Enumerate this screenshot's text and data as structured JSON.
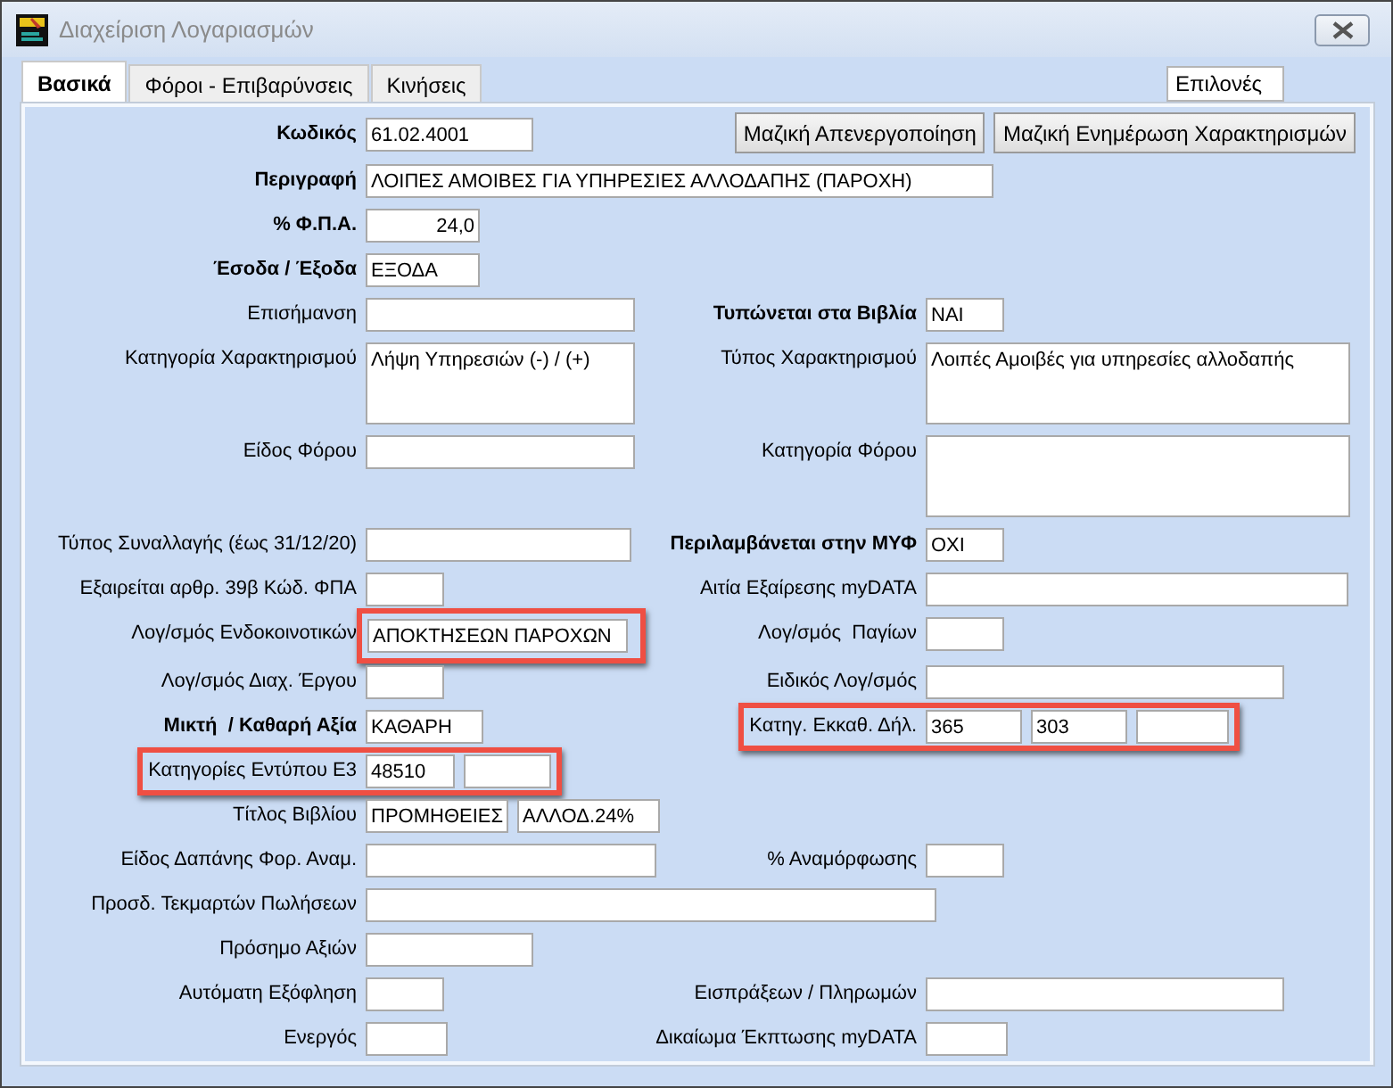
{
  "window": {
    "title": "Διαχείριση Λογαριασμών"
  },
  "tabs": [
    {
      "label": "Βασικά",
      "selected": true
    },
    {
      "label": "Φόροι - Επιβαρύνσεις",
      "selected": false
    },
    {
      "label": "Κινήσεις",
      "selected": false
    }
  ],
  "options_label": "Επιλονές",
  "buttons": [
    "Μαζική Απενεργοποίηση",
    "Μαζική Ενημέρωση Χαρακτηρισμών"
  ],
  "rows": [
    {
      "left": {
        "label": "Κωδικός",
        "bold": true,
        "fields": [
          {
            "kind": "text",
            "value": "61.02.4001"
          }
        ]
      }
    },
    {
      "left": {
        "label": "Περιγραφή",
        "bold": true,
        "fields": [
          {
            "kind": "text",
            "value": "ΛΟΙΠΕΣ ΑΜΟΙΒΕΣ ΓΙΑ ΥΠΗΡΕΣΙΕΣ ΑΛΛΟΔΑΠΗΣ (ΠΑΡΟΧΗ)"
          }
        ]
      }
    },
    {
      "left": {
        "label": "% Φ.Π.Α.",
        "bold": true,
        "fields": [
          {
            "kind": "number",
            "value": "24,0"
          }
        ]
      }
    },
    {
      "left": {
        "label": "Έσοδα / Έξοδα",
        "bold": true,
        "fields": [
          {
            "kind": "text",
            "value": "ΕΞΟΔΑ"
          }
        ]
      }
    },
    {
      "left": {
        "label": "Επισήμανση",
        "bold": false,
        "fields": [
          {
            "kind": "text"
          }
        ]
      },
      "right": {
        "label": "Τυπώνεται στα Βιβλία",
        "bold": true,
        "fields": [
          {
            "kind": "text",
            "value": "ΝΑΙ"
          }
        ]
      }
    },
    {
      "left": {
        "label": "Κατηγορία Χαρακτηρισμού",
        "bold": false,
        "fields": [
          {
            "kind": "textarea",
            "value": "Λήψη Υπηρεσιών (-) / (+)"
          }
        ]
      },
      "right": {
        "label": "Τύπος Χαρακτηρισμού",
        "bold": false,
        "fields": [
          {
            "kind": "textarea",
            "value": "Λοιπές Αμοιβές για υπηρεσίες αλλοδαπής"
          }
        ]
      }
    },
    {
      "left": {
        "label": "Είδος Φόρου",
        "bold": false,
        "fields": [
          {
            "kind": "text"
          }
        ]
      },
      "right": {
        "label": "Κατηγορία Φόρου",
        "bold": false,
        "fields": [
          {
            "kind": "textarea"
          }
        ]
      }
    },
    {
      "left": {
        "label": "Τύπος Συναλλαγής (έως 31/12/20)",
        "bold": false,
        "fields": [
          {
            "kind": "text"
          }
        ]
      },
      "right": {
        "label": "Περιλαμβάνεται στην ΜΥΦ",
        "bold": true,
        "fields": [
          {
            "kind": "text",
            "value": "ΟΧΙ"
          }
        ]
      }
    },
    {
      "left": {
        "label": "Εξαιρείται αρθρ. 39β Κώδ. ΦΠΑ",
        "bold": false,
        "fields": [
          {
            "kind": "text"
          }
        ]
      },
      "right": {
        "label": "Αιτία Εξαίρεσης myDATA",
        "bold": false,
        "fields": [
          {
            "kind": "text"
          }
        ]
      }
    },
    {
      "left": {
        "label": "Λογ/σμός Ενδοκοινοτικών",
        "bold": false,
        "fields": [
          {
            "kind": "text",
            "value": "ΑΠΟΚΤΗΣΕΩΝ ΠΑΡΟΧΩΝ",
            "highlighted": true
          }
        ]
      },
      "right": {
        "label": "Λογ/σμός  Παγίων",
        "bold": false,
        "fields": [
          {
            "kind": "text"
          }
        ]
      }
    },
    {
      "left": {
        "label": "Λογ/σμός Διαχ. Έργου",
        "bold": false,
        "fields": [
          {
            "kind": "text"
          }
        ]
      },
      "right": {
        "label": "Ειδικός Λογ/σμός",
        "bold": false,
        "fields": [
          {
            "kind": "text"
          }
        ]
      }
    },
    {
      "left": {
        "label": "Μικτή  / Καθαρή Αξία",
        "bold": true,
        "fields": [
          {
            "kind": "text",
            "value": "ΚΑΘΑΡΗ"
          }
        ]
      },
      "right": {
        "label": "Κατηγ. Εκκαθ. Δήλ.",
        "bold": false,
        "highlighted": true,
        "fields": [
          {
            "kind": "text",
            "value": "365"
          },
          {
            "kind": "text",
            "value": "303"
          },
          {
            "kind": "text"
          }
        ]
      }
    },
    {
      "left": {
        "label": "Κατηγορίες Εντύπου Ε3",
        "bold": false,
        "highlighted": true,
        "fields": [
          {
            "kind": "text",
            "value": "48510"
          },
          {
            "kind": "text"
          }
        ]
      }
    },
    {
      "left": {
        "label": "Τίτλος Βιβλίου",
        "bold": false,
        "fields": [
          {
            "kind": "text",
            "value": "ΠΡΟΜΗΘΕΙΕΣ"
          },
          {
            "kind": "text",
            "value": "ΑΛΛΟΔ.24%"
          }
        ]
      }
    },
    {
      "left": {
        "label": "Είδος Δαπάνης Φορ. Αναμ.",
        "bold": false,
        "fields": [
          {
            "kind": "text"
          }
        ]
      },
      "right": {
        "label": "% Αναμόρφωσης",
        "bold": false,
        "fields": [
          {
            "kind": "text"
          }
        ]
      }
    },
    {
      "left": {
        "label": "Προσδ. Τεκμαρτών Πωλήσεων",
        "bold": false,
        "fields": [
          {
            "kind": "text"
          }
        ]
      }
    },
    {
      "left": {
        "label": "Πρόσημο Αξιών",
        "bold": false,
        "fields": [
          {
            "kind": "text"
          }
        ]
      }
    },
    {
      "left": {
        "label": "Αυτόματη Εξόφληση",
        "bold": false,
        "fields": [
          {
            "kind": "text"
          }
        ]
      },
      "right": {
        "label": "Εισπράξεων / Πληρωμών",
        "bold": false,
        "fields": [
          {
            "kind": "text"
          }
        ]
      }
    },
    {
      "left": {
        "label": "Ενεργός",
        "bold": false,
        "fields": [
          {
            "kind": "text"
          }
        ]
      },
      "right": {
        "label": "Δικαίωμα Έκπτωσης myDATA",
        "bold": false,
        "fields": [
          {
            "kind": "text"
          }
        ]
      }
    }
  ]
}
